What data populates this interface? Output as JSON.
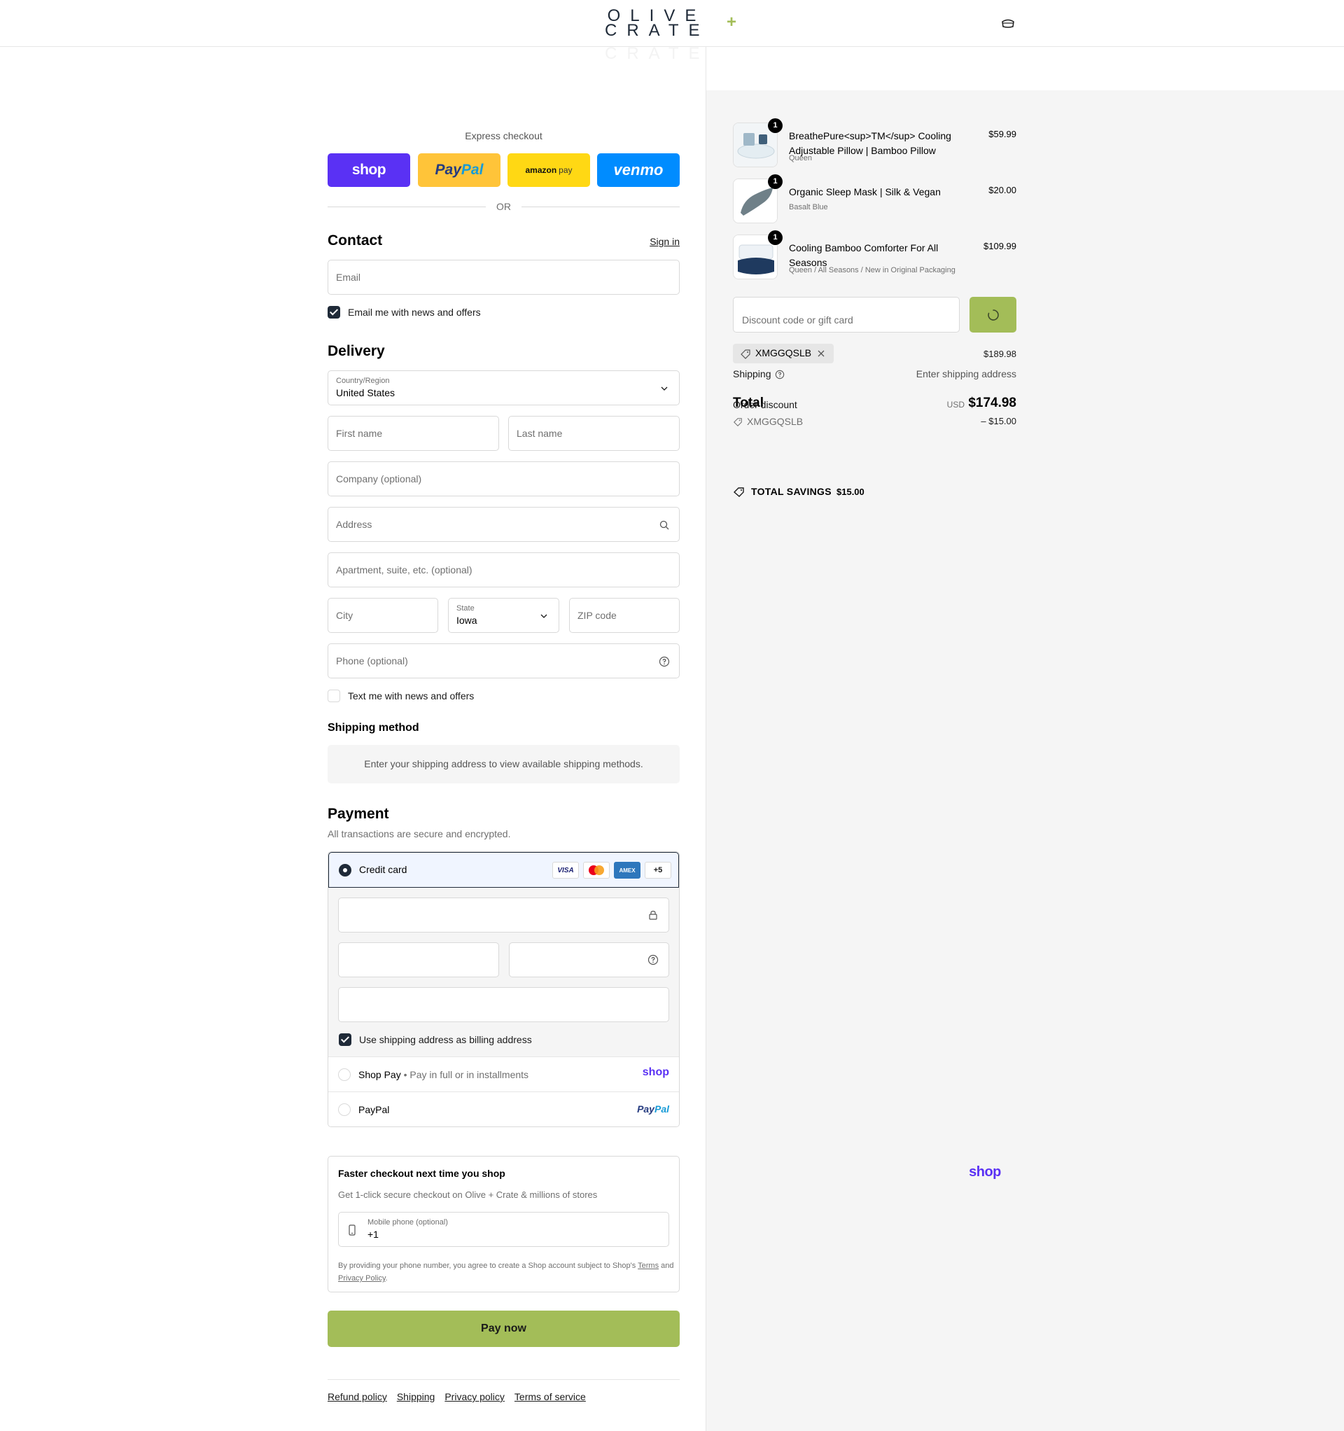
{
  "header": {
    "logo_line1": "OLIVE",
    "logo_line2": "CRATE",
    "logo_plus": "+",
    "ghost_text": "CRATE"
  },
  "express": {
    "label": "Express checkout",
    "shop": "shop",
    "paypal_a": "Pay",
    "paypal_b": "Pal",
    "amazon": "amazon",
    "amazon_pay": "pay",
    "venmo": "venmo",
    "or": "OR"
  },
  "contact": {
    "title": "Contact",
    "sign_in": "Sign in",
    "email_placeholder": "Email",
    "news_label": "Email me with news and offers"
  },
  "delivery": {
    "title": "Delivery",
    "country_label": "Country/Region",
    "country_value": "United States",
    "first_name": "First name",
    "last_name": "Last name",
    "company": "Company (optional)",
    "address": "Address",
    "apartment": "Apartment, suite, etc. (optional)",
    "city": "City",
    "state_label": "State",
    "state_value": "Iowa",
    "zip": "ZIP code",
    "phone": "Phone (optional)",
    "text_label": "Text me with news and offers"
  },
  "shipping_method": {
    "title": "Shipping method",
    "message": "Enter your shipping address to view available shipping methods."
  },
  "payment": {
    "title": "Payment",
    "subtitle": "All transactions are secure and encrypted.",
    "credit_card": "Credit card",
    "card_visa": "VISA",
    "card_amex": "AMEX",
    "card_more": "+5",
    "billing_label": "Use shipping address as billing address",
    "shop_pay": "Shop Pay",
    "shop_pay_sub": "Pay in full or in installments",
    "shop_logo": "shop",
    "paypal": "PayPal",
    "paypal_logo_a": "Pay",
    "paypal_logo_b": "Pal"
  },
  "shop_promo": {
    "title": "Faster checkout next time you shop",
    "logo": "shop",
    "description": "Get 1-click secure checkout on Olive + Crate & millions of stores",
    "mobile_label": "Mobile phone (optional)",
    "mobile_value": "+1",
    "terms_before": "By providing your phone number, you agree to create a Shop account subject to Shop's",
    "terms_link": "Terms",
    "terms_and": "and",
    "privacy_link": "Privacy Policy",
    "terms_end": "."
  },
  "pay_now": "Pay now",
  "footer": {
    "links": [
      "Refund policy",
      "Shipping",
      "Privacy policy",
      "Terms of service"
    ]
  },
  "summary": {
    "items": [
      {
        "qty": "1",
        "name": "BreathePure<sup>TM</sup> Cooling Adjustable Pillow | Bamboo Pillow",
        "variant": "Queen",
        "price": "$59.99"
      },
      {
        "qty": "1",
        "name": "Organic Sleep Mask | Silk & Vegan",
        "variant": "Basalt Blue",
        "price": "$20.00"
      },
      {
        "qty": "1",
        "name": "Cooling Bamboo Comforter For All Seasons",
        "variant": "Queen / All Seasons / New in Original Packaging",
        "price": "$109.99"
      }
    ],
    "discount_placeholder": "Discount code or gift card",
    "applied_code": "XMGGQSLB",
    "subtotal_value": "$189.98",
    "shipping_label": "Shipping",
    "shipping_value": "Enter shipping address",
    "total_label": "Total",
    "order_discount_label": "Order discount",
    "currency": "USD",
    "total_value": "$174.98",
    "discount_code": "XMGGQSLB",
    "discount_value": "– $15.00",
    "savings_label": "TOTAL SAVINGS",
    "savings_value": "$15.00"
  },
  "colors": {
    "brand_green": "#a3bd58",
    "shop_purple": "#5a31f4",
    "paypal_yellow": "#ffc439",
    "amazon_yellow": "#ffd814",
    "venmo_blue": "#008cff",
    "navy": "#1f2a38"
  }
}
